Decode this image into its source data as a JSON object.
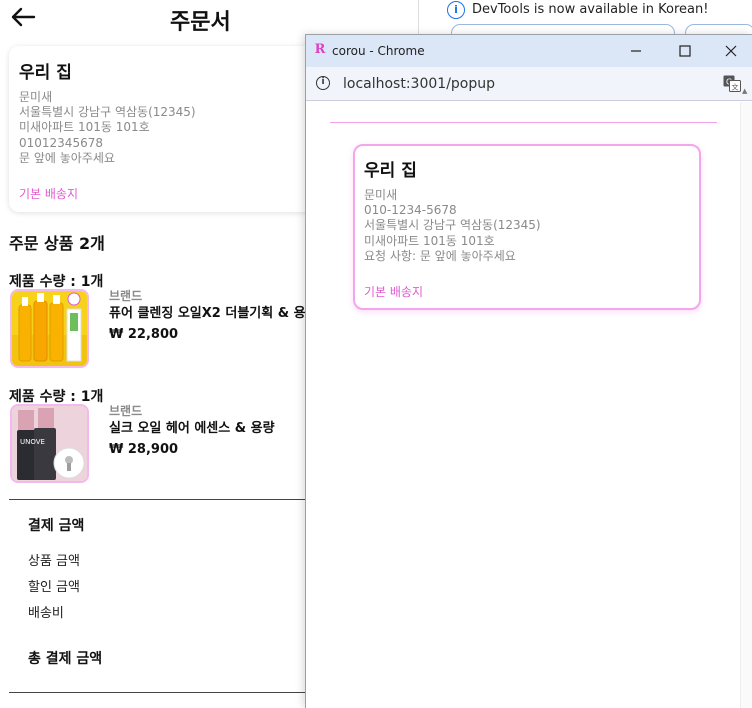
{
  "order_page": {
    "title": "주문서",
    "address_card": {
      "name": "우리 집",
      "recipient": "문미새",
      "address": "서울특별시 강남구 역삼동(12345)",
      "address_detail": "미새아파트 101동 101호",
      "phone": "01012345678",
      "request": "문 앞에 놓아주세요",
      "tag": "기본 배송지"
    },
    "items_heading": "주문 상품 2개",
    "products": [
      {
        "quantity_label": "제품 수량 : 1개",
        "brand": "브랜드",
        "name": "퓨어 클렌징 오일X2 더블기획 & 용",
        "price": "₩ 22,800"
      },
      {
        "quantity_label": "제품 수량 : 1개",
        "brand": "브랜드",
        "name": "실크 오일 헤어 에센스 & 용량",
        "price": "₩ 28,900"
      }
    ],
    "payment": {
      "heading": "결제 금액",
      "rows": [
        "상품 금액",
        "할인 금액",
        "배송비"
      ],
      "total_label": "총 결제 금액"
    }
  },
  "devtools": {
    "message": "DevTools is now available in Korean!"
  },
  "popup_window": {
    "title": "corou - Chrome",
    "favicon_letter": "R",
    "url": "localhost:3001/popup",
    "address_card": {
      "name": "우리 집",
      "recipient": "문미새",
      "phone": "010-1234-5678",
      "address": "서울특별시 강남구 역삼동(12345)",
      "address_detail": "미새아파트 101동 101호",
      "request": "요청 사항: 문 앞에 놓아주세요",
      "tag": "기본 배송지"
    }
  },
  "colors": {
    "accent_pink": "#e05bd0",
    "card_border_pink": "#f4a6ec",
    "titlebar_blue": "#dbe6f6"
  },
  "icons": [
    "back-arrow-icon",
    "info-icon",
    "minimize-icon",
    "maximize-icon",
    "close-icon",
    "site-info-icon",
    "translate-icon"
  ]
}
